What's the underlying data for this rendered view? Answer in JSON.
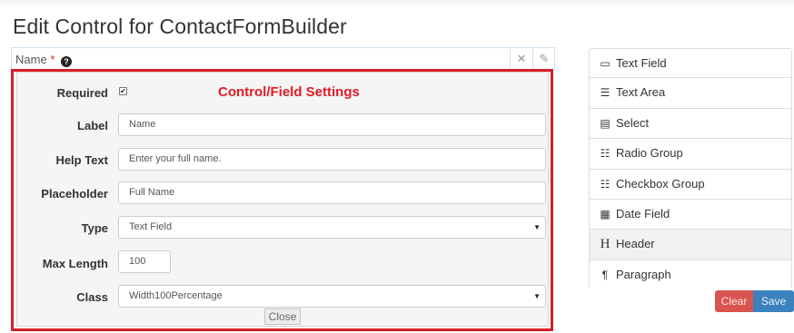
{
  "page_title": "Edit Control for ContactFormBuilder",
  "field_header": {
    "label": "Name",
    "required_mark": "*",
    "help_icon": "?",
    "close_glyph": "✕",
    "edit_glyph": "✎"
  },
  "settings": {
    "section_title": "Control/Field Settings",
    "required_label": "Required",
    "required_checked": true,
    "checkmark": "✔",
    "label_label": "Label",
    "label_value": "Name",
    "help_text_label": "Help Text",
    "help_text_value": "Enter your full name.",
    "placeholder_label": "Placeholder",
    "placeholder_value": "Full Name",
    "type_label": "Type",
    "type_value": "Text Field",
    "max_length_label": "Max Length",
    "max_length_value": "100",
    "class_label": "Class",
    "class_value": "Width100Percentage",
    "close_label": "Close",
    "caret": "▼"
  },
  "palette": {
    "items": [
      {
        "label": "Text Field",
        "icon": "text-field-icon",
        "glyph": "▭"
      },
      {
        "label": "Text Area",
        "icon": "text-area-icon",
        "glyph": "☰"
      },
      {
        "label": "Select",
        "icon": "select-icon",
        "glyph": "▤"
      },
      {
        "label": "Radio Group",
        "icon": "radio-group-icon",
        "glyph": "☷"
      },
      {
        "label": "Checkbox Group",
        "icon": "checkbox-group-icon",
        "glyph": "☷"
      },
      {
        "label": "Date Field",
        "icon": "calendar-icon",
        "glyph": "▦"
      },
      {
        "label": "Header",
        "icon": "header-icon",
        "glyph": "H"
      },
      {
        "label": "Paragraph",
        "icon": "paragraph-icon",
        "glyph": "¶"
      }
    ]
  },
  "actions": {
    "clear_label": "Clear",
    "save_label": "Save"
  },
  "colors": {
    "highlight_border": "#d71f26",
    "section_title": "#e01b24",
    "clear_button": "#d9534f",
    "save_button": "#3b82bf"
  }
}
